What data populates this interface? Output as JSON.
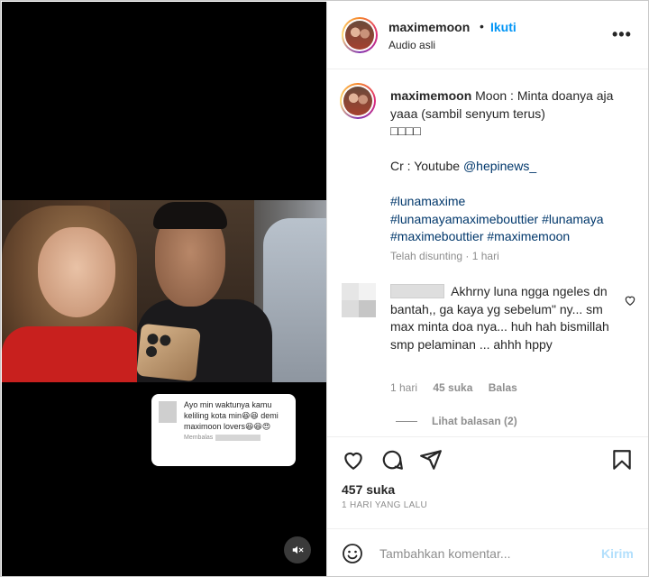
{
  "header": {
    "username": "maximemoon",
    "separator": "•",
    "follow_label": "Ikuti",
    "audio_label": "Audio asli",
    "more_label": "•••"
  },
  "caption": {
    "username": "maximemoon",
    "line1": "Moon : Minta doanya aja yaaa (sambil senyum terus)",
    "emoji_line": "□□□□",
    "credit_prefix": "Cr : Youtube ",
    "credit_handle": "@hepinews_",
    "hashtags": [
      "#lunamaxime",
      "#lunamayamaximebouttier",
      "#lunamaya",
      "#maximebouttier",
      "#maximemoon"
    ],
    "edited": "Telah disunting · 1 hari"
  },
  "comment": {
    "text": "Akhrny luna ngga ngeles dn bantah,, ga kaya yg sebelum\" ny... sm max minta doa nya... huh hah bismillah smp pelaminan ... ahhh hppy",
    "time": "1 hari",
    "likes": "45 suka",
    "reply_label": "Balas",
    "view_replies": "Lihat balasan (2)"
  },
  "actions": {
    "likes_count": "457 suka",
    "date": "1 HARI YANG LALU"
  },
  "add_comment": {
    "placeholder": "Tambahkan komentar...",
    "send_label": "Kirim"
  },
  "video": {
    "reply_card_text": "Ayo min waktunya kamu keliling kota min😆😆 demi maximoon lovers😆😆😍",
    "reply_card_meta": "Membalas"
  }
}
